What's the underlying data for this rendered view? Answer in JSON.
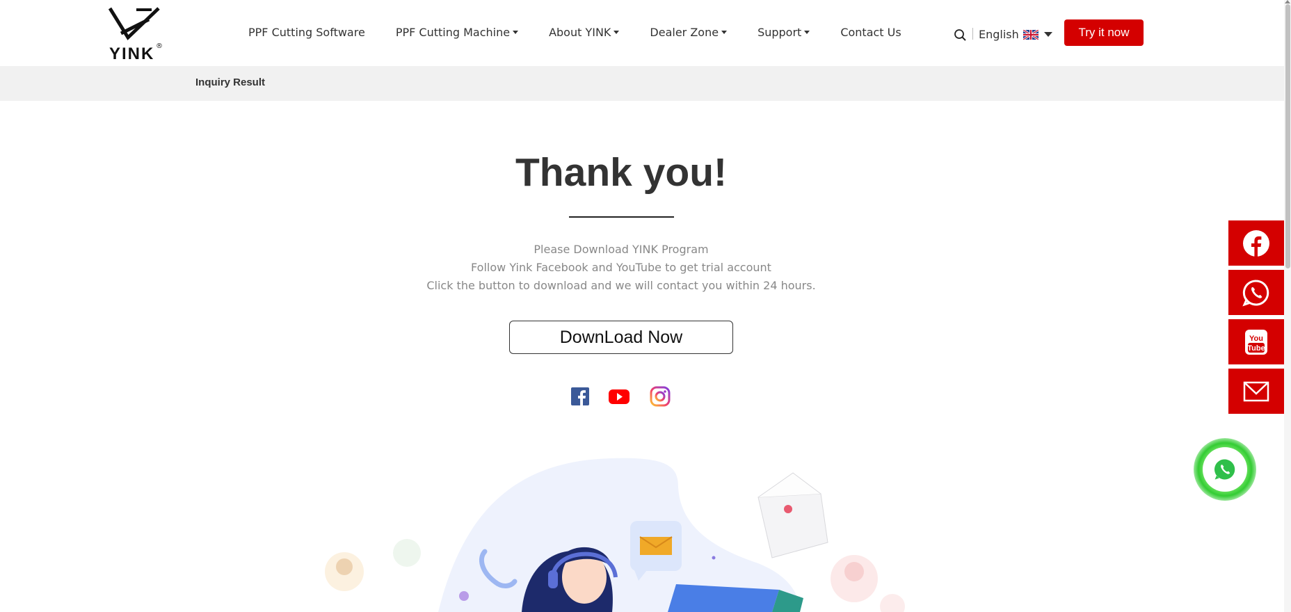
{
  "header": {
    "logo_text": "YINK",
    "logo_mark": "®",
    "nav": [
      {
        "label": "PPF Cutting Software",
        "dropdown": false
      },
      {
        "label": "PPF Cutting Machine",
        "dropdown": true
      },
      {
        "label": "About YINK",
        "dropdown": true
      },
      {
        "label": "Dealer Zone",
        "dropdown": true
      },
      {
        "label": "Support",
        "dropdown": true
      },
      {
        "label": "Contact Us",
        "dropdown": false
      }
    ],
    "language": "English",
    "cta_label": "Try it now"
  },
  "breadcrumb": "Inquiry Result",
  "main": {
    "title": "Thank you!",
    "lines": [
      "Please Download YINK Program",
      "Follow Yink Facebook and YouTube to get trial account",
      "Click the button to download and we will contact you within 24 hours."
    ],
    "download_label": "DownLoad Now",
    "social": [
      "facebook-icon",
      "youtube-icon",
      "instagram-icon"
    ]
  },
  "sidebar": [
    "facebook-icon",
    "whatsapp-icon",
    "youtube-icon",
    "mail-icon"
  ],
  "colors": {
    "brand_red": "#d40000",
    "whatsapp_green": "#33cc33",
    "facebook_blue": "#3b5998"
  }
}
